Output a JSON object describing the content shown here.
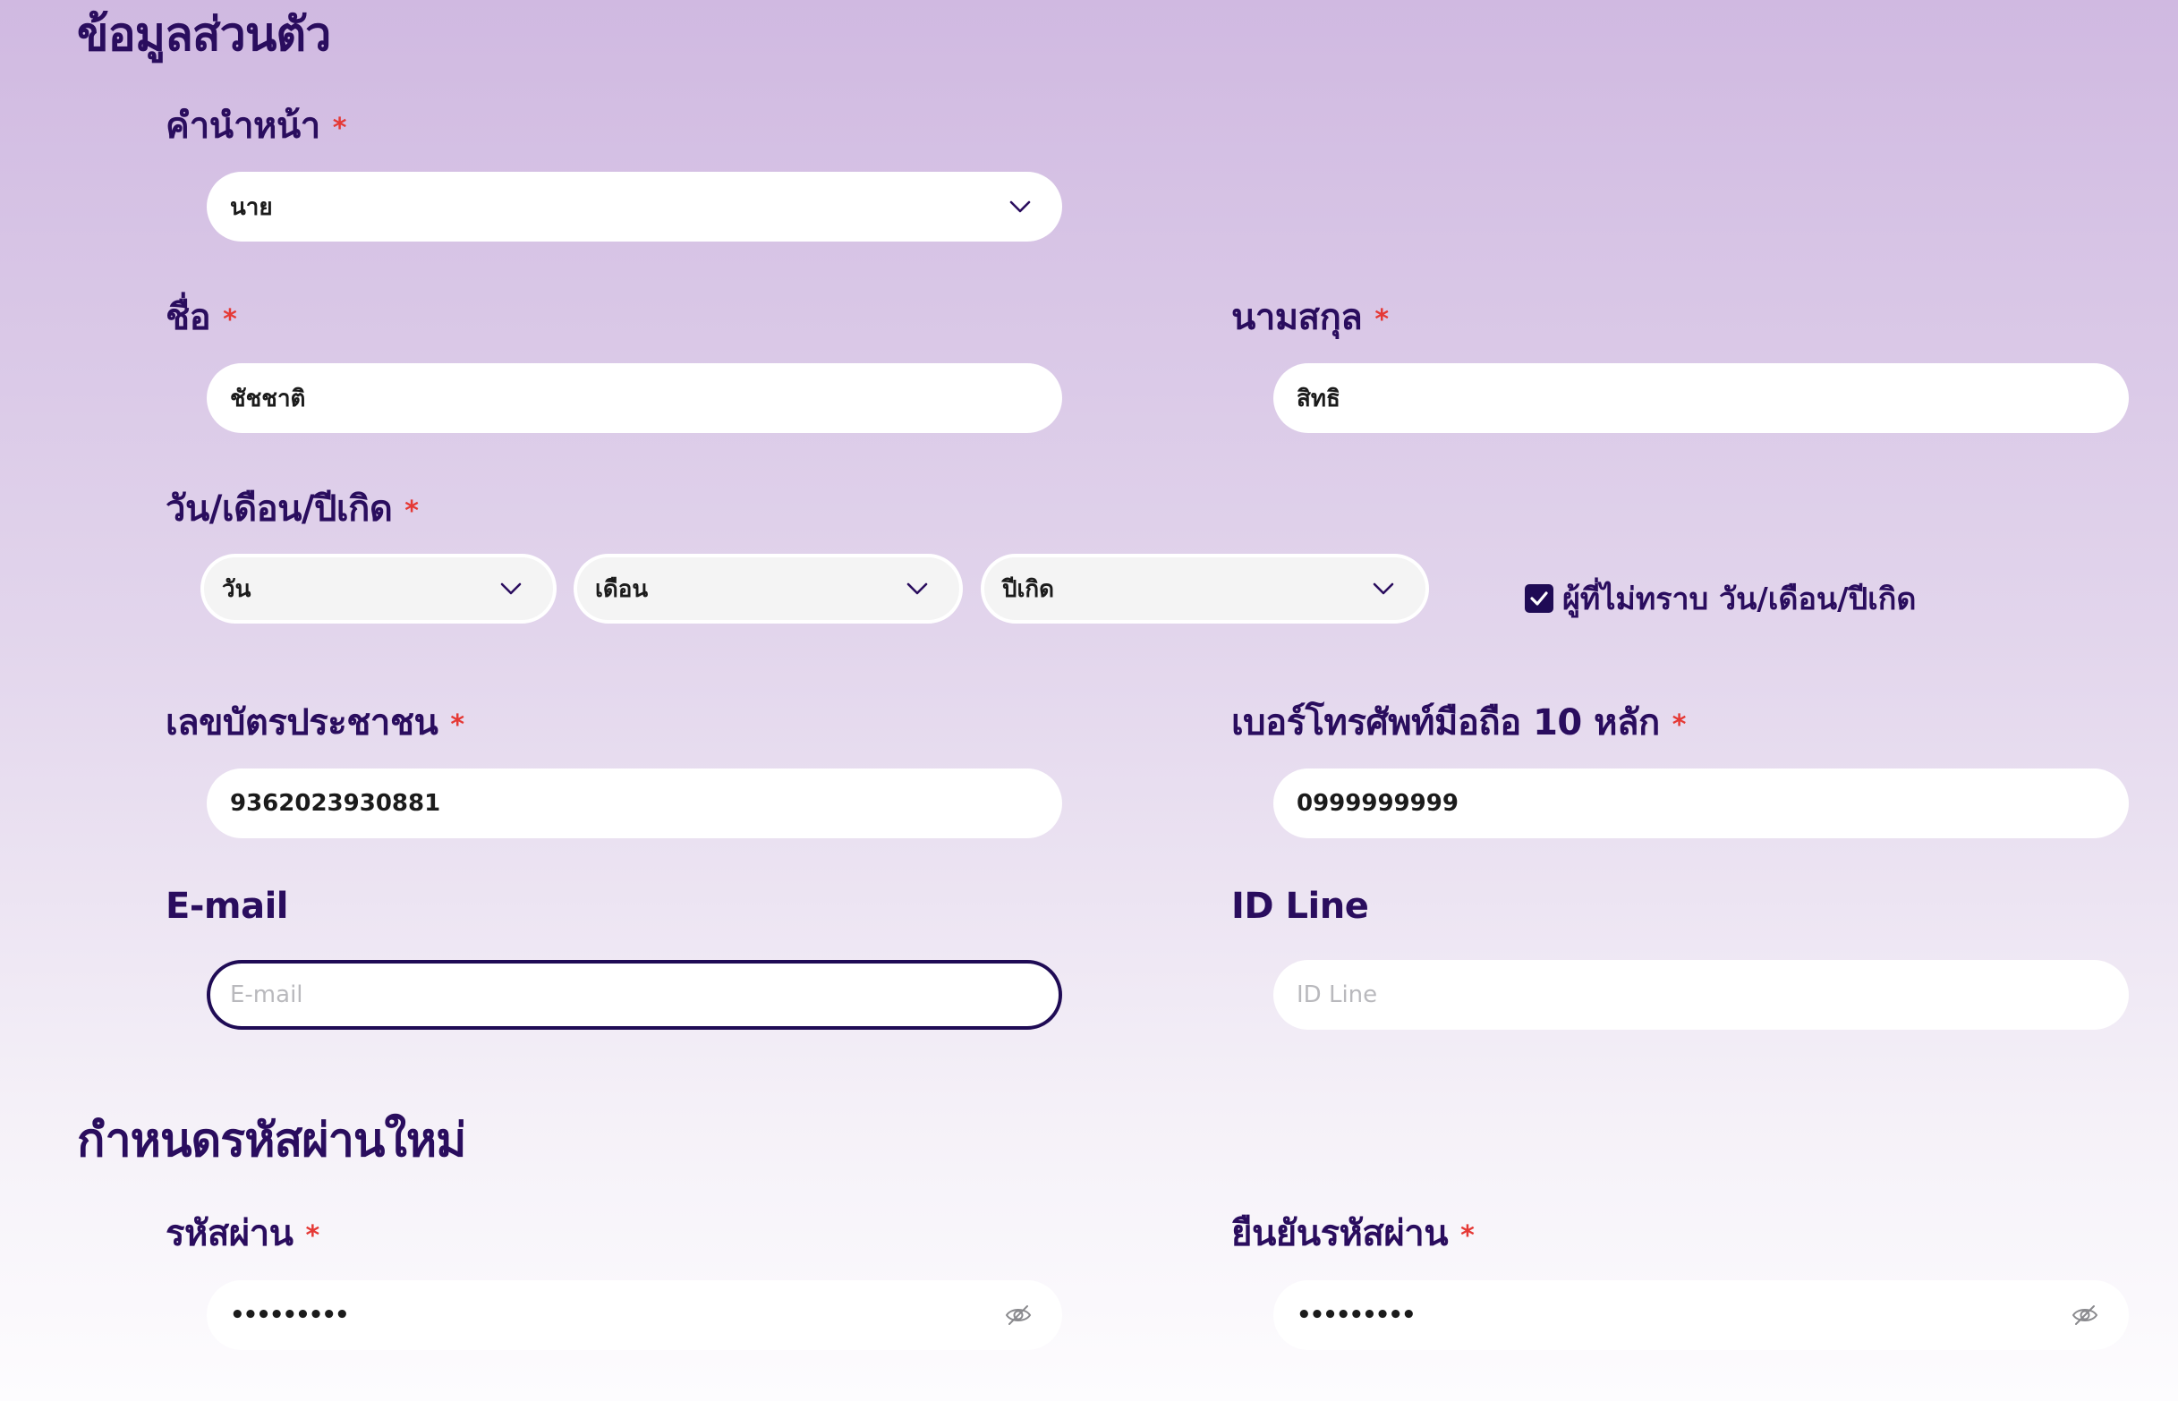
{
  "personal_section": {
    "title": "ข้อมูลส่วนตัว"
  },
  "title_field": {
    "label": "คำนำหน้า",
    "value": "นาย",
    "required_mark": "*"
  },
  "first_name": {
    "label": "ชื่อ",
    "value": "ชัชชาติ",
    "required_mark": "*"
  },
  "last_name": {
    "label": "นามสกุล",
    "value": "สิทธิ",
    "required_mark": "*"
  },
  "birthdate": {
    "label": "วัน/เดือน/ปีเกิด",
    "required_mark": "*",
    "day": "วัน",
    "month": "เดือน",
    "year": "ปีเกิด",
    "unknown_label": "ผู้ที่ไม่ทราบ วัน/เดือน/ปีเกิด"
  },
  "id_card": {
    "label": "เลขบัตรประชาชน",
    "value": "9362023930881",
    "required_mark": "*"
  },
  "phone": {
    "label": "เบอร์โทรศัพท์มือถือ 10 หลัก",
    "value": "0999999999",
    "required_mark": "*"
  },
  "email": {
    "label": "E-mail",
    "placeholder": "E-mail"
  },
  "line_id": {
    "label": "ID Line",
    "placeholder": "ID Line"
  },
  "password_section": {
    "title": "กำหนดรหัสผ่านใหม่"
  },
  "password": {
    "label": "รหัสผ่าน",
    "value": "•••••••••",
    "required_mark": "*"
  },
  "confirm_password": {
    "label": "ยืนยันรหัสผ่าน",
    "value": "•••••••••",
    "required_mark": "*"
  },
  "colors": {
    "primary": "#2a0d5e",
    "required": "#e53935",
    "focus_border": "#1f0b55"
  },
  "icons": {
    "dropdown": "chevron-down-icon",
    "password_toggle": "eye-slash-icon",
    "checkbox": "checkmark-icon"
  }
}
